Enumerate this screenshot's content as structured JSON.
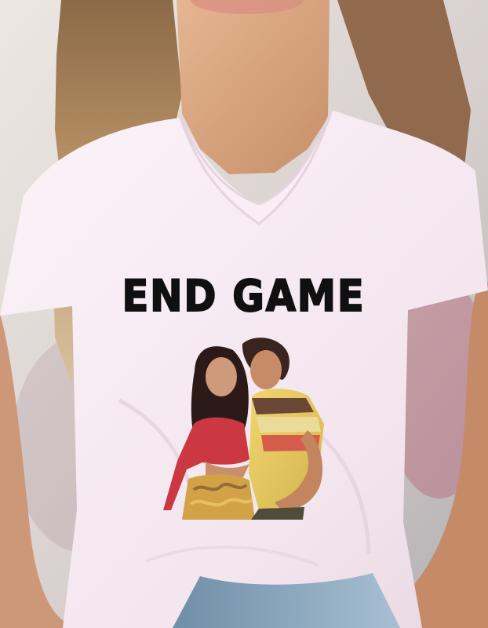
{
  "shirt": {
    "print_text": "END GAME"
  },
  "colors": {
    "background": "#d9d2cf",
    "shirt": "#f5e8ef",
    "hair": "#b78f63",
    "skin": "#d9a783",
    "jeans": "#86a4bd",
    "accent_red": "#c83d43",
    "accent_yellow": "#d8b24a"
  }
}
